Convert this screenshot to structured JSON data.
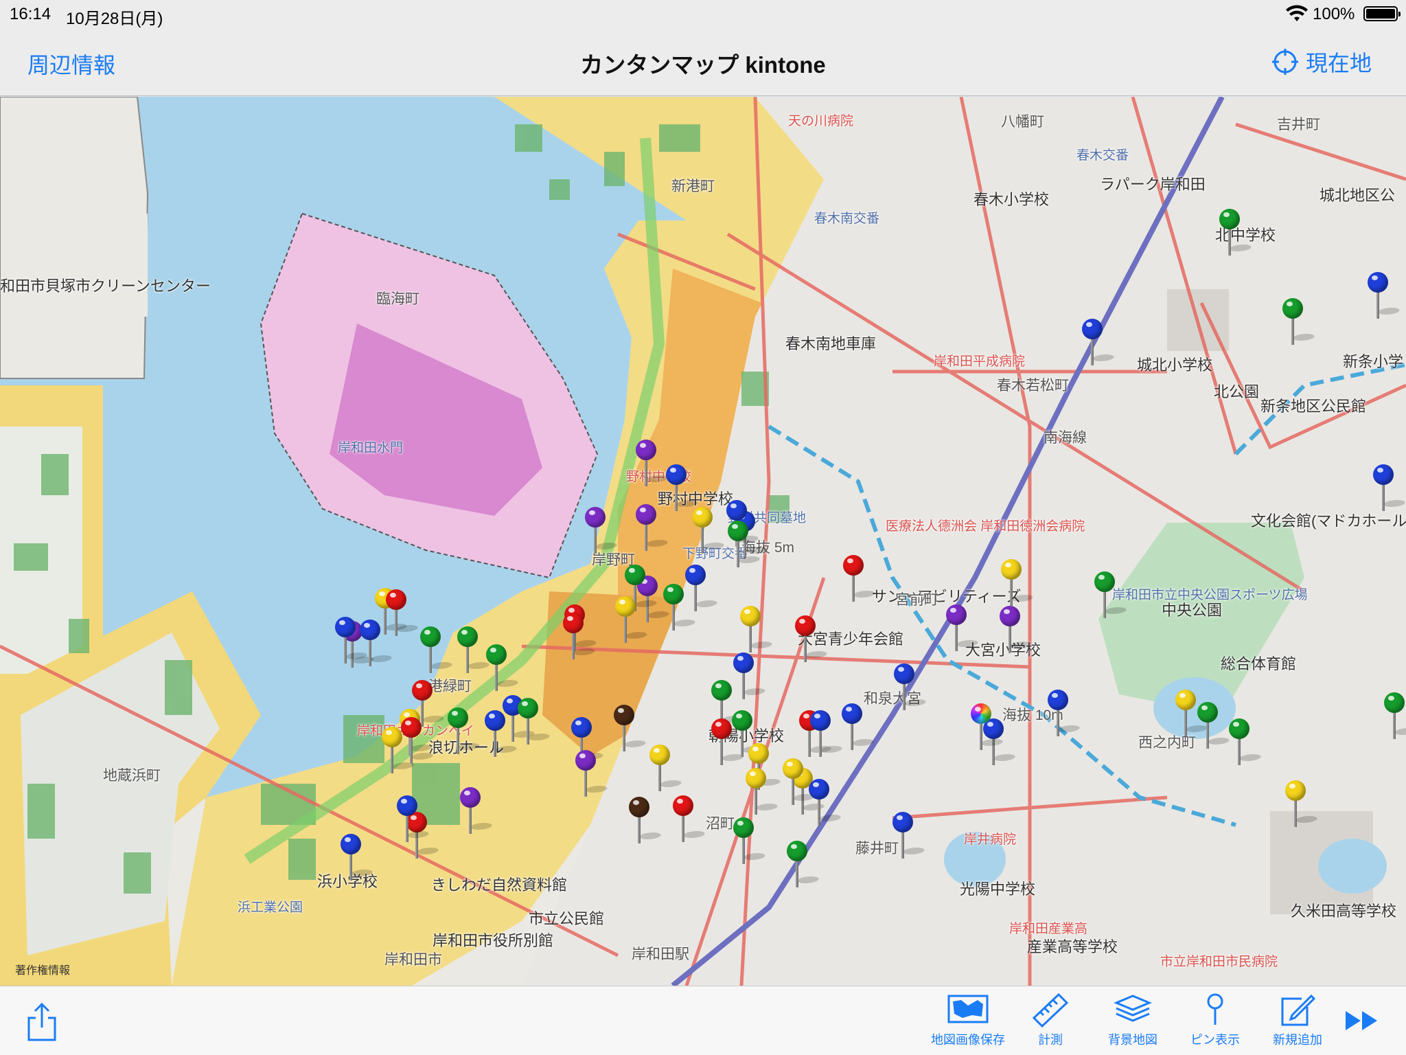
{
  "status": {
    "time": "16:14",
    "date": "10月28日(月)",
    "battery": "100%"
  },
  "nav": {
    "left_label": "周辺情報",
    "title": "カンタンマップ kintone",
    "right_label": "現在地"
  },
  "map": {
    "labels": [
      {
        "text": "和田市貝塚市クリーンセンター",
        "cls": "big"
      },
      {
        "text": "臨海町",
        "cls": ""
      },
      {
        "text": "岸和田水門",
        "cls": "blue"
      },
      {
        "text": "新港町",
        "cls": ""
      },
      {
        "text": "天の川病院",
        "cls": "red"
      },
      {
        "text": "八幡町",
        "cls": ""
      },
      {
        "text": "春木交番",
        "cls": "blue"
      },
      {
        "text": "吉井町",
        "cls": ""
      },
      {
        "text": "ラパーク岸和田",
        "cls": "big"
      },
      {
        "text": "春木小学校",
        "cls": "big"
      },
      {
        "text": "春木南交番",
        "cls": "blue"
      },
      {
        "text": "城北地区公",
        "cls": "big"
      },
      {
        "text": "北中学校",
        "cls": "big"
      },
      {
        "text": "春木南地車庫",
        "cls": "big"
      },
      {
        "text": "岸和田平成病院",
        "cls": "red"
      },
      {
        "text": "春木若松町",
        "cls": ""
      },
      {
        "text": "城北小学校",
        "cls": "big"
      },
      {
        "text": "北公園",
        "cls": "big"
      },
      {
        "text": "新条小学",
        "cls": "big"
      },
      {
        "text": "新条地区公民館",
        "cls": "big"
      },
      {
        "text": "南海線",
        "cls": ""
      },
      {
        "text": "野村中学校",
        "cls": "big"
      },
      {
        "text": "野村中学校",
        "cls": "red"
      },
      {
        "text": "野村共同墓地",
        "cls": "blue"
      },
      {
        "text": "医療法人德洲会 岸和田徳洲会病院",
        "cls": "red"
      },
      {
        "text": "文化会館(マドカホール",
        "cls": "big"
      },
      {
        "text": "岸野町",
        "cls": ""
      },
      {
        "text": "下野町交番",
        "cls": "blue"
      },
      {
        "text": "海抜 5m",
        "cls": ""
      },
      {
        "text": "サン・アビリティーズ",
        "cls": "big"
      },
      {
        "text": "宮前町",
        "cls": ""
      },
      {
        "text": "岸和田市立中央公園スポーツ広場",
        "cls": "blue"
      },
      {
        "text": "中央公園",
        "cls": "big"
      },
      {
        "text": "大宮青少年会館",
        "cls": "big"
      },
      {
        "text": "大宮小学校",
        "cls": "big"
      },
      {
        "text": "総合体育館",
        "cls": "big"
      },
      {
        "text": "港緑町",
        "cls": ""
      },
      {
        "text": "岸和田カンカンベイ",
        "cls": "red"
      },
      {
        "text": "浪切ホール",
        "cls": "big"
      },
      {
        "text": "朝陽小学校",
        "cls": "big"
      },
      {
        "text": "和泉大宮",
        "cls": ""
      },
      {
        "text": "海抜 10m",
        "cls": ""
      },
      {
        "text": "西之内町",
        "cls": ""
      },
      {
        "text": "地蔵浜町",
        "cls": ""
      },
      {
        "text": "沼町",
        "cls": ""
      },
      {
        "text": "藤井町",
        "cls": ""
      },
      {
        "text": "岸井病院",
        "cls": "red"
      },
      {
        "text": "浜小学校",
        "cls": "big"
      },
      {
        "text": "きしわだ自然資料館",
        "cls": "big"
      },
      {
        "text": "光陽中学校",
        "cls": "big"
      },
      {
        "text": "久米田高等学校",
        "cls": "big"
      },
      {
        "text": "浜工業公園",
        "cls": "blue"
      },
      {
        "text": "市立公民館",
        "cls": "big"
      },
      {
        "text": "岸和田市役所別館",
        "cls": "big"
      },
      {
        "text": "岸和田産業高",
        "cls": "red"
      },
      {
        "text": "産業高等学校",
        "cls": "big"
      },
      {
        "text": "岸和田市",
        "cls": ""
      },
      {
        "text": "岸和田駅",
        "cls": ""
      },
      {
        "text": "市立岸和田市民病院",
        "cls": "red"
      }
    ],
    "attribution": "著作権情報"
  },
  "pin_colors": {
    "blue": "#1f3fd8",
    "red": "#e01515",
    "green": "#159c2c",
    "purple": "#7b2cc4",
    "yellow": "#f2d21a",
    "brown": "#4a2a16"
  },
  "pins": [
    "green",
    "purple",
    "blue",
    "blue",
    "green",
    "blue",
    "green",
    "blue",
    "purple",
    "blue",
    "purple",
    "purple",
    "yellow",
    "blue",
    "green",
    "purple",
    "yellow",
    "green",
    "red",
    "blue",
    "yellow",
    "green",
    "yellow",
    "red",
    "red",
    "purple",
    "blue",
    "yellow",
    "red",
    "green",
    "yellow",
    "purple",
    "red",
    "green",
    "green",
    "green",
    "blue",
    "green",
    "yellow",
    "blue",
    "yellow",
    "blue",
    "red",
    "blue",
    "red",
    "green",
    "blue",
    "red",
    "green",
    "red",
    "green",
    "green",
    "red",
    "blue",
    "blue",
    "blue",
    "brown",
    "yellow",
    "brown",
    "yellow",
    "purple",
    "purple",
    "yellow",
    "yellow",
    "yellow",
    "blue",
    "blue",
    "red",
    "green",
    "blue",
    "green",
    "green",
    "blue",
    "blue",
    "green",
    "yellow",
    "blue",
    "rainbow"
  ],
  "toolbar": {
    "buttons": [
      {
        "label": "地図画像保存",
        "icon": "map-image-icon"
      },
      {
        "label": "計測",
        "icon": "ruler-icon"
      },
      {
        "label": "背景地図",
        "icon": "layers-icon"
      },
      {
        "label": "ピン表示",
        "icon": "pin-icon"
      },
      {
        "label": "新規追加",
        "icon": "compose-icon"
      }
    ]
  }
}
